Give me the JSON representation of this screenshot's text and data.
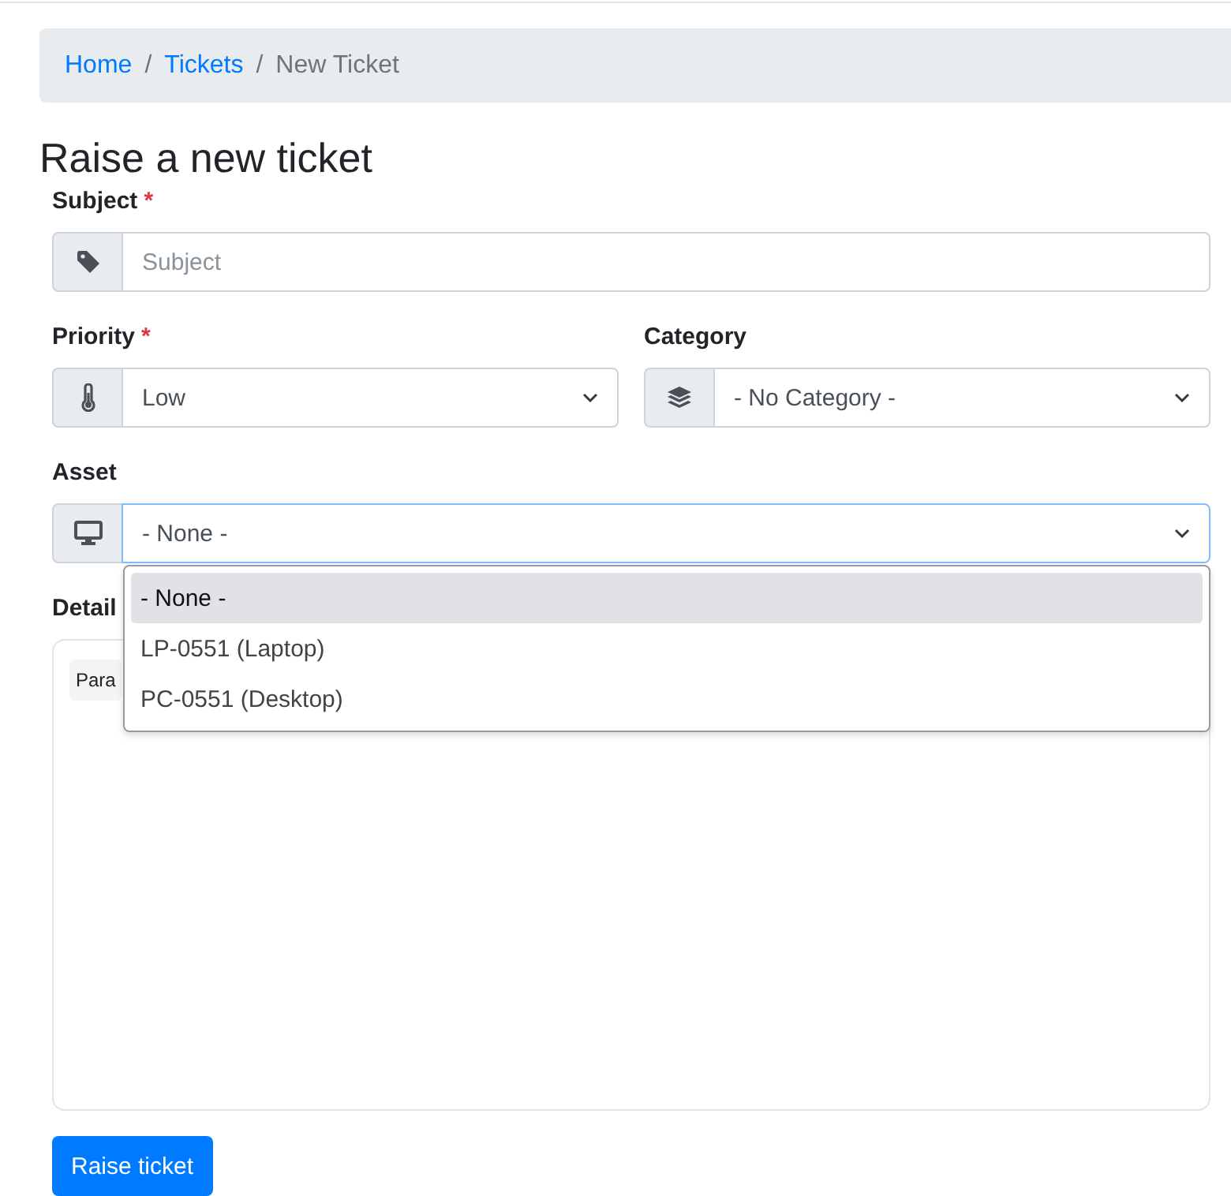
{
  "breadcrumb": [
    {
      "label": "Home",
      "kind": "link"
    },
    {
      "label": "Tickets",
      "kind": "link"
    },
    {
      "label": "New Ticket",
      "kind": "current"
    }
  ],
  "breadcrumb_separator": "/",
  "title": "Raise a new ticket",
  "required_mark": "*",
  "subject": {
    "label": "Subject",
    "required": true,
    "placeholder": "Subject"
  },
  "priority": {
    "label": "Priority",
    "required": true,
    "value": "Low"
  },
  "category": {
    "label": "Category",
    "required": false,
    "value": "- No Category -"
  },
  "asset": {
    "label": "Asset",
    "value": "- None -",
    "focused": true,
    "options": [
      {
        "label": "- None -",
        "selected": true
      },
      {
        "label": "LP-0551 (Laptop)",
        "selected": false
      },
      {
        "label": "PC-0551 (Desktop)",
        "selected": false
      }
    ]
  },
  "details": {
    "label": "Detail",
    "toolbar_item": "Para"
  },
  "submit_button": "Raise ticket"
}
